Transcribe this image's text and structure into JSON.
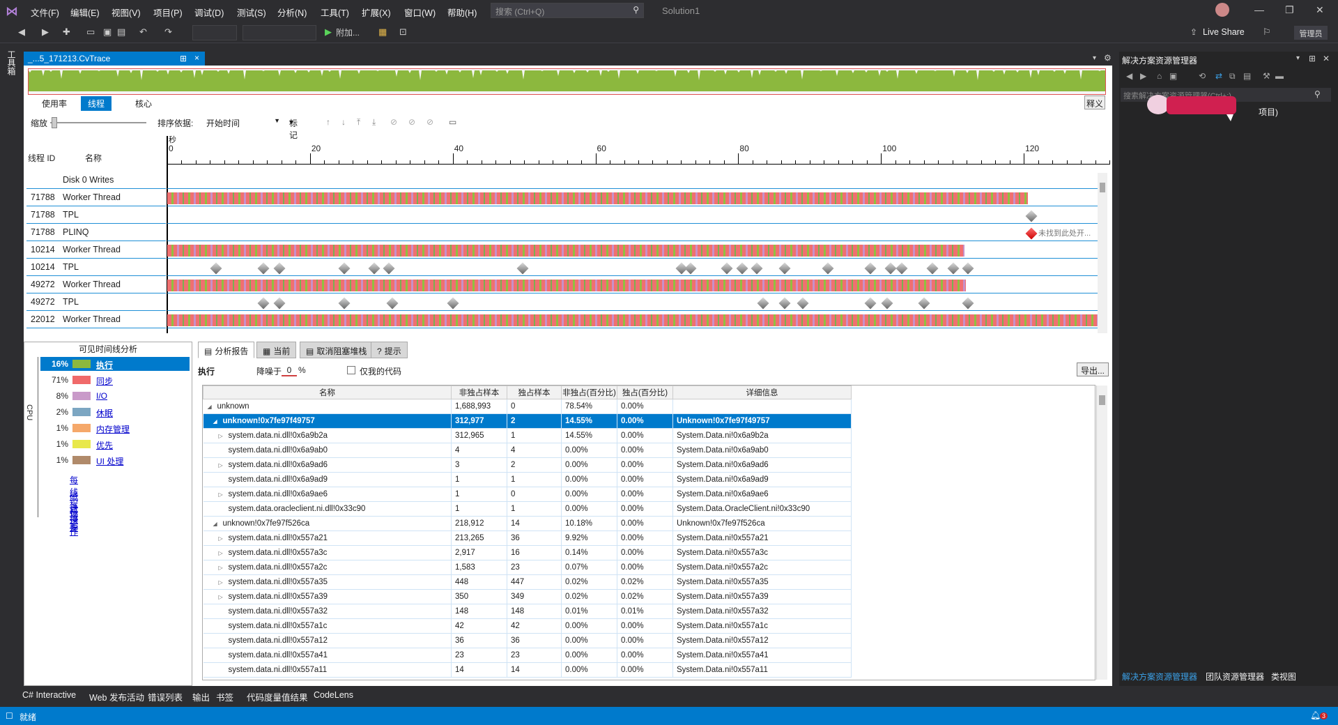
{
  "menu": [
    "文件(F)",
    "编辑(E)",
    "视图(V)",
    "项目(P)",
    "调试(D)",
    "测试(S)",
    "分析(N)",
    "工具(T)",
    "扩展(X)",
    "窗口(W)",
    "帮助(H)"
  ],
  "search": {
    "placeholder": "搜索 (Ctrl+Q)"
  },
  "solution_name": "Solution1",
  "toolbar": {
    "attach_label": "附加...",
    "live_share": "Live Share",
    "admin": "管理员"
  },
  "left_tab": "工具箱",
  "doc_tab": {
    "title": "_...5_171213.CvTrace",
    "pin": "⊞",
    "close": "×"
  },
  "view_tabs": [
    "使用率",
    "线程",
    "核心"
  ],
  "explain_btn": "释义",
  "controls": {
    "zoom": "缩放",
    "sort_by": "排序依据:",
    "sort_value": "开始时间",
    "marks": "标记"
  },
  "ruler": {
    "unit": "秒",
    "ticks": [
      "0",
      "20",
      "40",
      "60",
      "80",
      "100",
      "120"
    ]
  },
  "thread_header": {
    "id": "线程 ID",
    "name": "名称"
  },
  "threads": [
    {
      "id": "",
      "name": "Disk 0 Writes"
    },
    {
      "id": "71788",
      "name": "Worker Thread"
    },
    {
      "id": "71788",
      "name": "TPL"
    },
    {
      "id": "71788",
      "name": "PLINQ"
    },
    {
      "id": "10214",
      "name": "Worker Thread"
    },
    {
      "id": "10214",
      "name": "TPL"
    },
    {
      "id": "49272",
      "name": "Worker Thread"
    },
    {
      "id": "49272",
      "name": "TPL"
    },
    {
      "id": "22012",
      "name": "Worker Thread"
    }
  ],
  "plinq_note": "未找到此处开...",
  "left_panel": {
    "title": "可见时间线分析",
    "cpu_label": "CPU",
    "categories": [
      {
        "pct": "16%",
        "label": "执行",
        "color": "#8cb83e"
      },
      {
        "pct": "71%",
        "label": "同步",
        "color": "#f06a6a"
      },
      {
        "pct": "8%",
        "label": "I/O",
        "color": "#c99ac9"
      },
      {
        "pct": "2%",
        "label": "休眠",
        "color": "#7ca6c2"
      },
      {
        "pct": "1%",
        "label": "内存管理",
        "color": "#f5a86a"
      },
      {
        "pct": "1%",
        "label": "优先",
        "color": "#e8e84a"
      },
      {
        "pct": "1%",
        "label": "UI 处理",
        "color": "#b08a6a"
      }
    ],
    "links": [
      "每线程摘要",
      "磁盘操作",
      "标记"
    ]
  },
  "report_tabs": [
    "分析报告",
    "当前",
    "取消阻塞堆栈",
    "提示"
  ],
  "exec_row": {
    "title": "执行",
    "noise_label": "降噪于",
    "noise_value": "0",
    "percent": "%",
    "only_my_code": "仅我的代码",
    "export": "导出..."
  },
  "grid": {
    "headers": [
      "名称",
      "非独占样本",
      "独占样本",
      "非独占(百分比)",
      "独占(百分比)",
      "详细信息"
    ],
    "rows": [
      {
        "expander": "◢",
        "indent": 0,
        "cells": [
          "unknown",
          "1,688,993",
          "0",
          "78.54%",
          "0.00%",
          ""
        ]
      },
      {
        "expander": "◢",
        "indent": 1,
        "sel": true,
        "cells": [
          "unknown!0x7fe97f49757",
          "312,977",
          "2",
          "14.55%",
          "0.00%",
          "Unknown!0x7fe97f49757"
        ]
      },
      {
        "expander": "▷",
        "indent": 2,
        "cells": [
          "system.data.ni.dll!0x6a9b2a",
          "312,965",
          "1",
          "14.55%",
          "0.00%",
          "System.Data.ni!0x6a9b2a"
        ]
      },
      {
        "expander": "",
        "indent": 2,
        "cells": [
          "system.data.ni.dll!0x6a9ab0",
          "4",
          "4",
          "0.00%",
          "0.00%",
          "System.Data.ni!0x6a9ab0"
        ]
      },
      {
        "expander": "▷",
        "indent": 2,
        "cells": [
          "system.data.ni.dll!0x6a9ad6",
          "3",
          "2",
          "0.00%",
          "0.00%",
          "System.Data.ni!0x6a9ad6"
        ]
      },
      {
        "expander": "",
        "indent": 2,
        "cells": [
          "system.data.ni.dll!0x6a9ad9",
          "1",
          "1",
          "0.00%",
          "0.00%",
          "System.Data.ni!0x6a9ad9"
        ]
      },
      {
        "expander": "▷",
        "indent": 2,
        "cells": [
          "system.data.ni.dll!0x6a9ae6",
          "1",
          "0",
          "0.00%",
          "0.00%",
          "System.Data.ni!0x6a9ae6"
        ]
      },
      {
        "expander": "",
        "indent": 2,
        "cells": [
          "system.data.oracleclient.ni.dll!0x33c90",
          "1",
          "1",
          "0.00%",
          "0.00%",
          "System.Data.OracleClient.ni!0x33c90"
        ]
      },
      {
        "expander": "◢",
        "indent": 1,
        "cells": [
          "unknown!0x7fe97f526ca",
          "218,912",
          "14",
          "10.18%",
          "0.00%",
          "Unknown!0x7fe97f526ca"
        ]
      },
      {
        "expander": "▷",
        "indent": 2,
        "cells": [
          "system.data.ni.dll!0x557a21",
          "213,265",
          "36",
          "9.92%",
          "0.00%",
          "System.Data.ni!0x557a21"
        ]
      },
      {
        "expander": "▷",
        "indent": 2,
        "cells": [
          "system.data.ni.dll!0x557a3c",
          "2,917",
          "16",
          "0.14%",
          "0.00%",
          "System.Data.ni!0x557a3c"
        ]
      },
      {
        "expander": "▷",
        "indent": 2,
        "cells": [
          "system.data.ni.dll!0x557a2c",
          "1,583",
          "23",
          "0.07%",
          "0.00%",
          "System.Data.ni!0x557a2c"
        ]
      },
      {
        "expander": "▷",
        "indent": 2,
        "cells": [
          "system.data.ni.dll!0x557a35",
          "448",
          "447",
          "0.02%",
          "0.02%",
          "System.Data.ni!0x557a35"
        ]
      },
      {
        "expander": "▷",
        "indent": 2,
        "cells": [
          "system.data.ni.dll!0x557a39",
          "350",
          "349",
          "0.02%",
          "0.02%",
          "System.Data.ni!0x557a39"
        ]
      },
      {
        "expander": "",
        "indent": 2,
        "cells": [
          "system.data.ni.dll!0x557a32",
          "148",
          "148",
          "0.01%",
          "0.01%",
          "System.Data.ni!0x557a32"
        ]
      },
      {
        "expander": "",
        "indent": 2,
        "cells": [
          "system.data.ni.dll!0x557a1c",
          "42",
          "42",
          "0.00%",
          "0.00%",
          "System.Data.ni!0x557a1c"
        ]
      },
      {
        "expander": "",
        "indent": 2,
        "cells": [
          "system.data.ni.dll!0x557a12",
          "36",
          "36",
          "0.00%",
          "0.00%",
          "System.Data.ni!0x557a12"
        ]
      },
      {
        "expander": "",
        "indent": 2,
        "cells": [
          "system.data.ni.dll!0x557a41",
          "23",
          "23",
          "0.00%",
          "0.00%",
          "System.Data.ni!0x557a41"
        ]
      },
      {
        "expander": "",
        "indent": 2,
        "cells": [
          "system.data.ni.dll!0x557a11",
          "14",
          "14",
          "0.00%",
          "0.00%",
          "System.Data.ni!0x557a11"
        ]
      }
    ]
  },
  "solution_explorer": {
    "title": "解决方案资源管理器",
    "search_placeholder": "搜索解决方案资源管理器(Ctrl+;)",
    "item": "项目)",
    "tabs": [
      "解决方案资源管理器",
      "团队资源管理器",
      "类视图"
    ]
  },
  "bottom_tabs": [
    "C# Interactive",
    "Web 发布活动",
    "错误列表",
    "输出",
    "书签",
    "代码度量值结果",
    "CodeLens"
  ],
  "status": {
    "text": "就绪",
    "notifications": "3"
  }
}
